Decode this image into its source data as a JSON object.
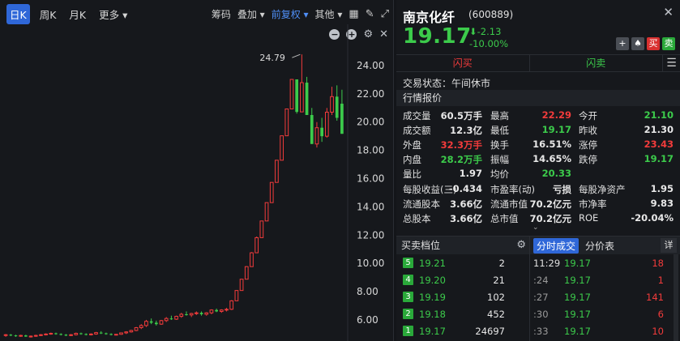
{
  "toolbar": {
    "tabs": [
      "日K",
      "周K",
      "月K",
      "更多 ▾"
    ],
    "active_tab": 0,
    "items": [
      "筹码",
      "叠加 ▾",
      "前复权 ▾",
      "其他 ▾"
    ]
  },
  "chart_data": {
    "type": "candlestick",
    "yticks": [
      "24.00",
      "22.00",
      "20.00",
      "18.00",
      "16.00",
      "14.00",
      "12.00",
      "10.00",
      "8.00",
      "6.00"
    ],
    "ylim": [
      4.85,
      25.2
    ],
    "annotation": "24.79",
    "colors": {
      "up": "#f23b3b",
      "down": "#3ccb4b"
    },
    "candles": [
      [
        4.9,
        5.0,
        4.8,
        4.95
      ],
      [
        4.95,
        5.0,
        4.85,
        4.9
      ],
      [
        4.9,
        4.95,
        4.8,
        4.85
      ],
      [
        4.85,
        4.95,
        4.8,
        4.9
      ],
      [
        4.9,
        4.95,
        4.8,
        4.82
      ],
      [
        4.82,
        4.9,
        4.75,
        4.85
      ],
      [
        4.85,
        4.95,
        4.8,
        4.9
      ],
      [
        4.9,
        5.0,
        4.85,
        4.95
      ],
      [
        4.95,
        5.05,
        4.9,
        5.0
      ],
      [
        5.0,
        5.1,
        4.95,
        5.05
      ],
      [
        5.05,
        5.1,
        4.95,
        5.0
      ],
      [
        5.0,
        5.05,
        4.9,
        4.95
      ],
      [
        4.95,
        5.0,
        4.85,
        4.9
      ],
      [
        4.9,
        5.0,
        4.85,
        4.95
      ],
      [
        4.95,
        5.1,
        4.9,
        5.05
      ],
      [
        5.05,
        5.1,
        4.95,
        5.0
      ],
      [
        5.0,
        5.05,
        4.9,
        4.95
      ],
      [
        4.95,
        5.05,
        4.9,
        5.0
      ],
      [
        5.0,
        5.15,
        4.95,
        5.1
      ],
      [
        5.1,
        5.2,
        5.0,
        5.05
      ],
      [
        5.05,
        5.1,
        4.95,
        5.0
      ],
      [
        5.0,
        5.05,
        4.9,
        4.95
      ],
      [
        4.95,
        5.0,
        4.9,
        4.98
      ],
      [
        4.98,
        5.1,
        4.95,
        5.08
      ],
      [
        5.08,
        5.2,
        5.0,
        5.15
      ],
      [
        5.15,
        5.3,
        5.1,
        5.25
      ],
      [
        5.25,
        5.5,
        5.2,
        5.45
      ],
      [
        5.45,
        5.7,
        5.35,
        5.6
      ],
      [
        5.6,
        6.0,
        5.5,
        5.9
      ],
      [
        5.9,
        6.1,
        5.7,
        5.8
      ],
      [
        5.8,
        5.95,
        5.6,
        5.7
      ],
      [
        5.7,
        6.0,
        5.65,
        5.95
      ],
      [
        5.95,
        6.2,
        5.85,
        6.1
      ],
      [
        6.1,
        6.3,
        6.0,
        6.05
      ],
      [
        6.05,
        6.3,
        6.0,
        6.25
      ],
      [
        6.25,
        6.5,
        6.15,
        6.4
      ],
      [
        6.4,
        6.6,
        6.3,
        6.35
      ],
      [
        6.35,
        6.5,
        6.2,
        6.45
      ],
      [
        6.45,
        6.6,
        6.35,
        6.5
      ],
      [
        6.5,
        6.6,
        6.3,
        6.4
      ],
      [
        6.4,
        6.55,
        6.3,
        6.5
      ],
      [
        6.5,
        6.75,
        6.4,
        6.7
      ],
      [
        6.7,
        6.8,
        6.55,
        6.6
      ],
      [
        6.6,
        6.75,
        6.5,
        6.7
      ],
      [
        6.7,
        6.85,
        6.6,
        6.75
      ],
      [
        6.75,
        7.4,
        6.7,
        7.35
      ],
      [
        7.35,
        8.1,
        7.35,
        8.08
      ],
      [
        8.08,
        8.9,
        8.08,
        8.88
      ],
      [
        8.88,
        9.8,
        8.88,
        9.77
      ],
      [
        9.77,
        10.8,
        9.77,
        10.75
      ],
      [
        10.75,
        11.9,
        10.75,
        11.82
      ],
      [
        11.82,
        13.0,
        11.82,
        13.0
      ],
      [
        13.0,
        14.3,
        13.0,
        14.3
      ],
      [
        14.3,
        15.75,
        14.3,
        15.73
      ],
      [
        15.73,
        17.3,
        15.73,
        17.3
      ],
      [
        17.3,
        19.0,
        17.3,
        19.03
      ],
      [
        19.03,
        20.9,
        19.03,
        20.93
      ],
      [
        20.93,
        23.0,
        20.93,
        23.02
      ],
      [
        23.02,
        21.5,
        20.6,
        20.72
      ],
      [
        20.72,
        24.79,
        20.7,
        22.79
      ],
      [
        22.79,
        23.2,
        20.5,
        20.5
      ],
      [
        20.5,
        21.0,
        18.45,
        18.45
      ],
      [
        18.45,
        20.0,
        18.2,
        19.6
      ],
      [
        19.6,
        20.3,
        18.6,
        19.0
      ],
      [
        19.0,
        21.0,
        18.9,
        20.7
      ],
      [
        20.7,
        22.5,
        20.5,
        21.8
      ],
      [
        21.8,
        22.6,
        20.1,
        20.3
      ],
      [
        21.3,
        22.29,
        19.17,
        19.17
      ]
    ]
  },
  "quote": {
    "name": "南京化纤",
    "code": "(600889)",
    "price": "19.17",
    "change": "-2.13",
    "change_pct": "-10.00%",
    "header_buttons": [
      "+",
      "♠",
      "买",
      "卖"
    ],
    "flash_buy": "闪买",
    "flash_sell": "闪卖",
    "status": "交易状态：午间休市",
    "section_quote": "行情报价",
    "rows": [
      [
        {
          "l": "成交量",
          "v": "60.5万手",
          "c": "white"
        },
        {
          "l": "最高",
          "v": "22.29",
          "c": "red"
        },
        {
          "l": "今开",
          "v": "21.10",
          "c": "green"
        }
      ],
      [
        {
          "l": "成交额",
          "v": "12.3亿",
          "c": "white"
        },
        {
          "l": "最低",
          "v": "19.17",
          "c": "green"
        },
        {
          "l": "昨收",
          "v": "21.30",
          "c": "white"
        }
      ],
      [
        {
          "l": "外盘",
          "v": "32.3万手",
          "c": "red"
        },
        {
          "l": "换手",
          "v": "16.51%",
          "c": "white"
        },
        {
          "l": "涨停",
          "v": "23.43",
          "c": "red"
        }
      ],
      [
        {
          "l": "内盘",
          "v": "28.2万手",
          "c": "green"
        },
        {
          "l": "振幅",
          "v": "14.65%",
          "c": "white"
        },
        {
          "l": "跌停",
          "v": "19.17",
          "c": "green"
        }
      ],
      [
        {
          "l": "量比",
          "v": "1.97",
          "c": "white"
        },
        {
          "l": "均价",
          "v": "20.33",
          "c": "green"
        },
        {
          "l": "",
          "v": "",
          "c": "white"
        }
      ]
    ],
    "rows2": [
      [
        {
          "l": "每股收益(三)",
          "v": "-0.434",
          "c": "white"
        },
        {
          "l": "市盈率(动)",
          "v": "亏损",
          "c": "white"
        },
        {
          "l": "每股净资产",
          "v": "1.95",
          "c": "white"
        }
      ],
      [
        {
          "l": "流通股本",
          "v": "3.66亿",
          "c": "white"
        },
        {
          "l": "流通市值",
          "v": "70.2亿元",
          "c": "white"
        },
        {
          "l": "市净率",
          "v": "9.83",
          "c": "white"
        }
      ],
      [
        {
          "l": "总股本",
          "v": "3.66亿",
          "c": "white"
        },
        {
          "l": "总市值",
          "v": "70.2亿元",
          "c": "white"
        },
        {
          "l": "ROE",
          "v": "-20.04%",
          "c": "white"
        }
      ]
    ],
    "orderbook_title": "买卖档位",
    "orderbook": [
      {
        "lvl": "5",
        "price": "19.21",
        "vol": "2"
      },
      {
        "lvl": "4",
        "price": "19.20",
        "vol": "21"
      },
      {
        "lvl": "3",
        "price": "19.19",
        "vol": "102"
      },
      {
        "lvl": "2",
        "price": "19.18",
        "vol": "452"
      },
      {
        "lvl": "1",
        "price": "19.17",
        "vol": "24697"
      }
    ],
    "trades_tabs": [
      "分时成交",
      "分价表"
    ],
    "trades_detail": "详",
    "trades": [
      {
        "t": "11:29",
        "p": "19.17",
        "v": "18"
      },
      {
        "t": ":24",
        "p": "19.17",
        "v": "1"
      },
      {
        "t": ":27",
        "p": "19.17",
        "v": "141"
      },
      {
        "t": ":30",
        "p": "19.17",
        "v": "6"
      },
      {
        "t": ":33",
        "p": "19.17",
        "v": "10"
      }
    ]
  }
}
